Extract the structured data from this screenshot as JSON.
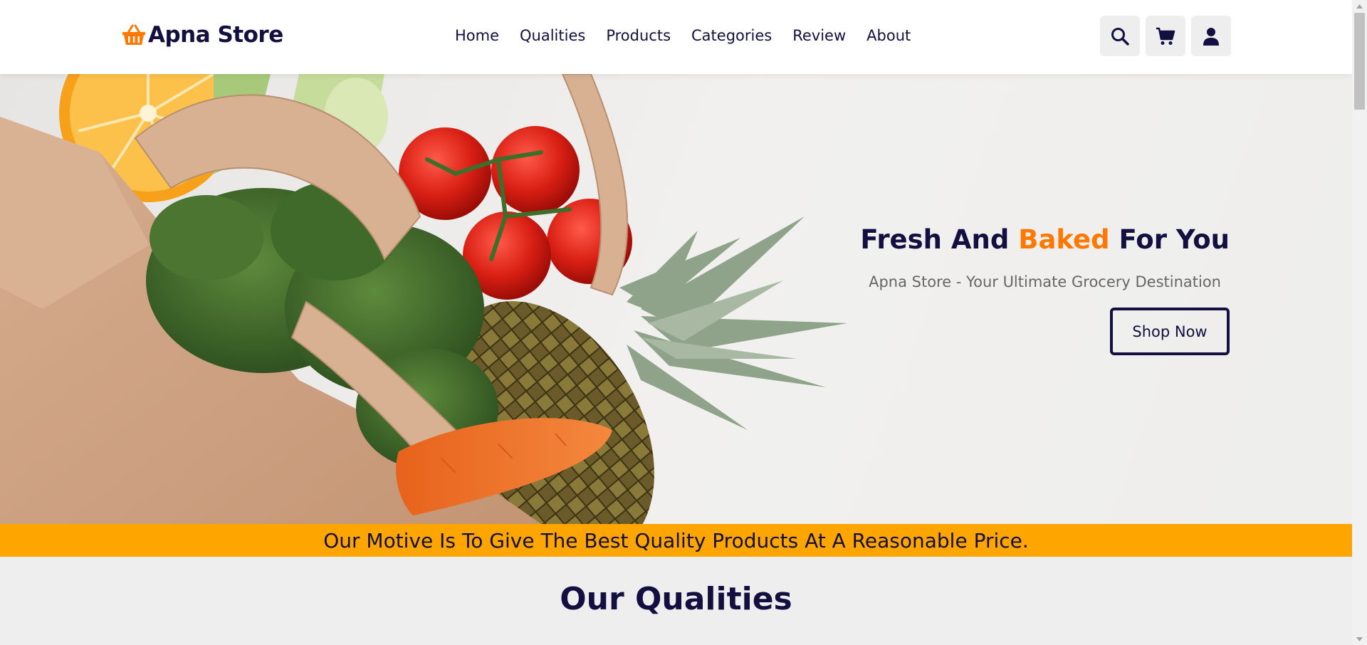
{
  "header": {
    "logo_text": "Apna Store",
    "nav": [
      "Home",
      "Qualities",
      "Products",
      "Categories",
      "Review",
      "About"
    ],
    "icons": [
      "search-icon",
      "cart-icon",
      "user-icon"
    ]
  },
  "hero": {
    "title_part1": "Fresh And ",
    "title_accent": "Baked",
    "title_part2": " For You",
    "subtitle": "Apna Store - Your Ultimate Grocery Destination",
    "button_label": "Shop Now"
  },
  "banner": {
    "text": "Our Motive Is To Give The Best Quality Products At A Reasonable Price."
  },
  "section": {
    "title": "Our Qualities"
  },
  "colors": {
    "primary": "#130f40",
    "accent": "#ff7800",
    "banner": "#ffa500",
    "background": "#eeeeee"
  }
}
